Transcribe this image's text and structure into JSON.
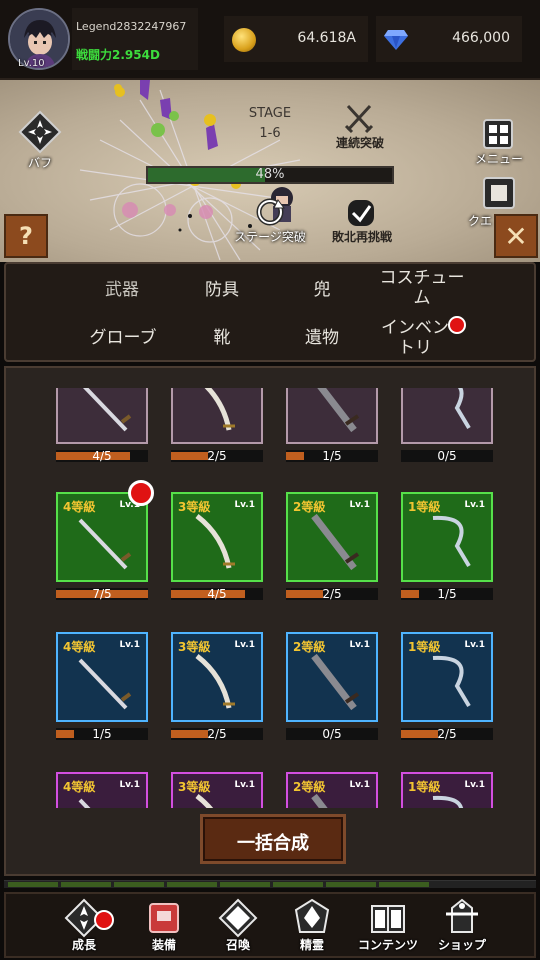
{
  "header": {
    "player_name": "Legend2832247967",
    "combat_power": "戦闘力2.954D",
    "level": "Lv.10",
    "gold": "64.618A",
    "gems": "466,000"
  },
  "scene": {
    "stage_label": "STAGE",
    "stage_number": "1-6",
    "buff_label": "バフ",
    "auto_label": "連続突破",
    "menu_label": "メニュー",
    "quest_label": "クエ",
    "progress_text": "48%",
    "progress_value": 48,
    "stage_break_label": "ステージ突破",
    "retry_label": "敗北再挑戦",
    "help_glyph": "?",
    "close_glyph": "✕"
  },
  "tabs": [
    {
      "label": "武器"
    },
    {
      "label": "防具"
    },
    {
      "label": "兜"
    },
    {
      "label": "コスチューム"
    },
    {
      "label": "グローブ"
    },
    {
      "label": "靴"
    },
    {
      "label": "遺物"
    },
    {
      "label": "インベントリ"
    }
  ],
  "items": {
    "row1": [
      {
        "progress": "4/5",
        "fill": 0.8
      },
      {
        "progress": "2/5",
        "fill": 0.4
      },
      {
        "progress": "1/5",
        "fill": 0.2
      },
      {
        "progress": "0/5",
        "fill": 0.0
      }
    ],
    "row2": [
      {
        "grade": "4等級",
        "level": "Lv.1",
        "progress": "7/5",
        "fill": 1.0
      },
      {
        "grade": "3等級",
        "level": "Lv.1",
        "progress": "4/5",
        "fill": 0.8
      },
      {
        "grade": "2等級",
        "level": "Lv.1",
        "progress": "2/5",
        "fill": 0.4
      },
      {
        "grade": "1等級",
        "level": "Lv.1",
        "progress": "1/5",
        "fill": 0.2
      }
    ],
    "row3": [
      {
        "grade": "4等級",
        "level": "Lv.1",
        "progress": "1/5",
        "fill": 0.2
      },
      {
        "grade": "3等級",
        "level": "Lv.1",
        "progress": "2/5",
        "fill": 0.4
      },
      {
        "grade": "2等級",
        "level": "Lv.1",
        "progress": "0/5",
        "fill": 0.0
      },
      {
        "grade": "1等級",
        "level": "Lv.1",
        "progress": "2/5",
        "fill": 0.4
      }
    ],
    "row4": [
      {
        "grade": "4等級",
        "level": "Lv.1"
      },
      {
        "grade": "3等級",
        "level": "Lv.1"
      },
      {
        "grade": "2等級",
        "level": "Lv.1"
      },
      {
        "grade": "1等級",
        "level": "Lv.1"
      }
    ]
  },
  "merge_button": "一括合成",
  "nav": [
    {
      "label": "成長",
      "icon": "growth-icon"
    },
    {
      "label": "装備",
      "icon": "equipment-icon"
    },
    {
      "label": "召喚",
      "icon": "summon-icon"
    },
    {
      "label": "精霊",
      "icon": "spirit-icon"
    },
    {
      "label": "コンテンツ",
      "icon": "content-icon"
    },
    {
      "label": "ショップ",
      "icon": "shop-icon"
    }
  ],
  "colors": {
    "green_tier": "#1f6b19",
    "blue_tier": "#12334f",
    "violet_tier": "#3a1d3d",
    "grade_text": "#f2c531",
    "combat_power": "#3ddc3d",
    "notification": "#e01212"
  }
}
